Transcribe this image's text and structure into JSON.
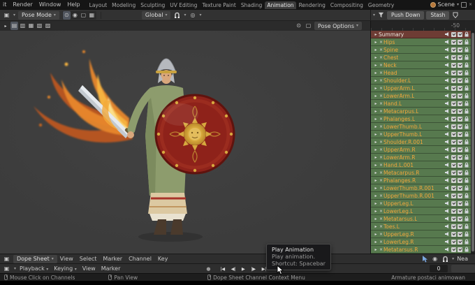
{
  "colors": {
    "topbar_bg": "#151515",
    "header_bg": "#323232",
    "subheader_bg": "#2b2b2b",
    "viewport_bg": "#3c3c3c",
    "panel_ruler_bg": "#242424",
    "channel_green": "#57794e",
    "channel_text": "#f0a63c",
    "summary_bg": "#6e3c34",
    "tab_active_bg": "#3d3d3d",
    "button_bg": "#4f4f4f",
    "dropdown_bg": "#404040",
    "statusbar_bg": "#1d1d1d",
    "tooltip_bg": "#19191b",
    "editor_bg": "#2e2e2e"
  },
  "topbar": {
    "menus": [
      "it",
      "Render",
      "Window",
      "Help"
    ],
    "tabs": [
      "Layout",
      "Modeling",
      "Sculpting",
      "UV Editing",
      "Texture Paint",
      "Shading",
      "Animation",
      "Rendering",
      "Compositing",
      "Geometry"
    ],
    "active_tab": "Animation",
    "scene": "Scene"
  },
  "viewport_header": {
    "mode": "Pose Mode",
    "orientation": "Global"
  },
  "tool_row": {
    "pose_options": "Pose Options"
  },
  "action_header": {
    "push_down": "Push Down",
    "stash": "Stash"
  },
  "ruler": {
    "frame_label": "-50"
  },
  "channels": {
    "summary": "Summary",
    "items": [
      "Hips",
      "Spine",
      "Chest",
      "Neck",
      "Head",
      "Shoulder.L",
      "UpperArm.L",
      "LowerArm.L",
      "Hand.L",
      "Metacarpus.L",
      "Phalanges.L",
      "LowerThumb.L",
      "UpperThumb.L",
      "Shoulder.R.001",
      "UpperArm.R",
      "LowerArm.R",
      "Hand.L.001",
      "Metacarpus.R",
      "Phalanges.R",
      "LowerThumb.R.001",
      "UpperThumb.R.001",
      "UpperLeg.L",
      "LowerLeg.L",
      "Metatarsus.L",
      "Toes.L",
      "UpperLeg.R",
      "LowerLeg.R",
      "Metatarsus.R"
    ]
  },
  "dopesheet": {
    "editor": "Dope Sheet",
    "menus": [
      "View",
      "Select",
      "Marker",
      "Channel",
      "Key"
    ],
    "snap": "Nea"
  },
  "timeline": {
    "playback": "Playback",
    "keying": "Keying",
    "menus": [
      "View",
      "Marker"
    ],
    "transport": [
      {
        "name": "jump-to-start",
        "glyph": "|◀"
      },
      {
        "name": "prev-keyframe",
        "glyph": "◀|"
      },
      {
        "name": "play",
        "glyph": "▶"
      },
      {
        "name": "next-keyframe",
        "glyph": "|▶"
      },
      {
        "name": "jump-to-end",
        "glyph": "▶|"
      }
    ],
    "frame": "0"
  },
  "tooltip": {
    "title": "Play Animation",
    "description": "Play animation.",
    "shortcut": "Shortcut: Spacebar"
  },
  "statusbar": {
    "items": [
      "Mouse Click on Channels",
      "Pan View",
      "Dope Sheet Channel Context Menu",
      "Armature postaci animowan"
    ]
  }
}
